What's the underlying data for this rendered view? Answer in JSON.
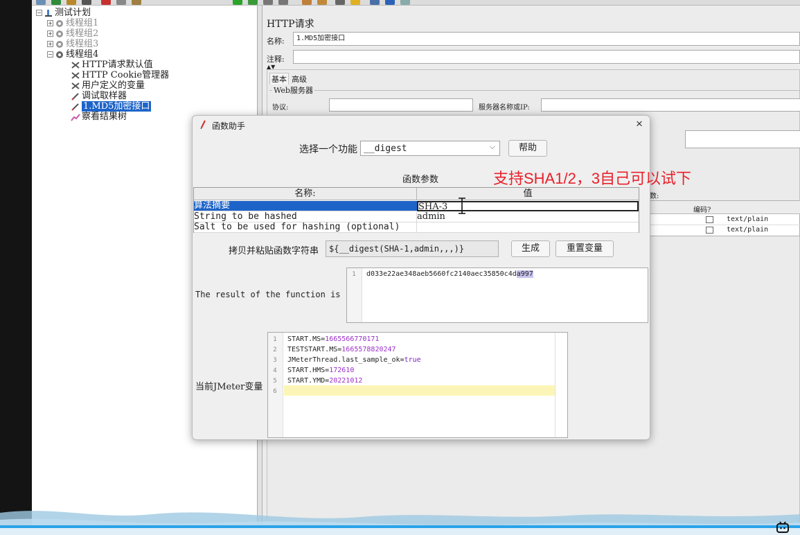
{
  "tree": {
    "root": "测试计划",
    "groups": [
      "线程组1",
      "线程组2",
      "线程组3",
      "线程组4"
    ],
    "children": [
      "HTTP请求默认值",
      "HTTP Cookie管理器",
      "用户定义的变量",
      "调试取样器",
      "1.MD5加密接口",
      "察看结果树"
    ]
  },
  "http_panel": {
    "title": "HTTP请求",
    "name_label": "名称:",
    "name_value": "1.MD5加密接口",
    "comment_label": "注释:",
    "tabs": [
      "基本",
      "高级"
    ],
    "web_server_label": "Web服务器",
    "protocol_label": "协议:",
    "server_label": "服务器名称或IP:",
    "params_label": "数:",
    "encode_header": "编码?",
    "content_types": [
      "text/plain",
      "text/plain"
    ]
  },
  "dialog": {
    "title": "函数助手",
    "close": "×",
    "select_label": "选择一个功能",
    "select_value": "__digest",
    "help_button": "帮助",
    "params_title": "函数参数",
    "columns": [
      "名称:",
      "值"
    ],
    "rows": [
      {
        "name": "算法摘要",
        "value": "SHA-3"
      },
      {
        "name": "String to be hashed",
        "value": "admin"
      },
      {
        "name": "Salt to be used for hashing (optional)",
        "value": ""
      }
    ],
    "copy_label": "拷贝并粘贴函数字符串",
    "function_string": "${__digest(SHA-1,admin,,,)}",
    "generate_button": "生成",
    "reset_button": "重置变量",
    "result_label": "The result of the function is",
    "result_line_number": "1",
    "result_main": "d033e22ae348aeb5660fc2140aec35850c4d",
    "result_highlight": "a997",
    "vars_label": "当前JMeter变量",
    "vars": [
      {
        "n": "1",
        "key": "START.MS=",
        "val": "1665566770171"
      },
      {
        "n": "2",
        "key": "TESTSTART.MS=",
        "val": "1665578820247"
      },
      {
        "n": "3",
        "key": "JMeterThread.last_sample_ok=",
        "val": "true"
      },
      {
        "n": "4",
        "key": "START.HMS=",
        "val": "172610"
      },
      {
        "n": "5",
        "key": "START.YMD=",
        "val": "20221012"
      },
      {
        "n": "6",
        "key": "",
        "val": ""
      }
    ]
  },
  "annotation": "支持SHA1/2，3自己可以试下",
  "colors": {
    "selection": "#1e64c8",
    "annotation": "#e8202a",
    "accent_line": "#29a3e8"
  }
}
